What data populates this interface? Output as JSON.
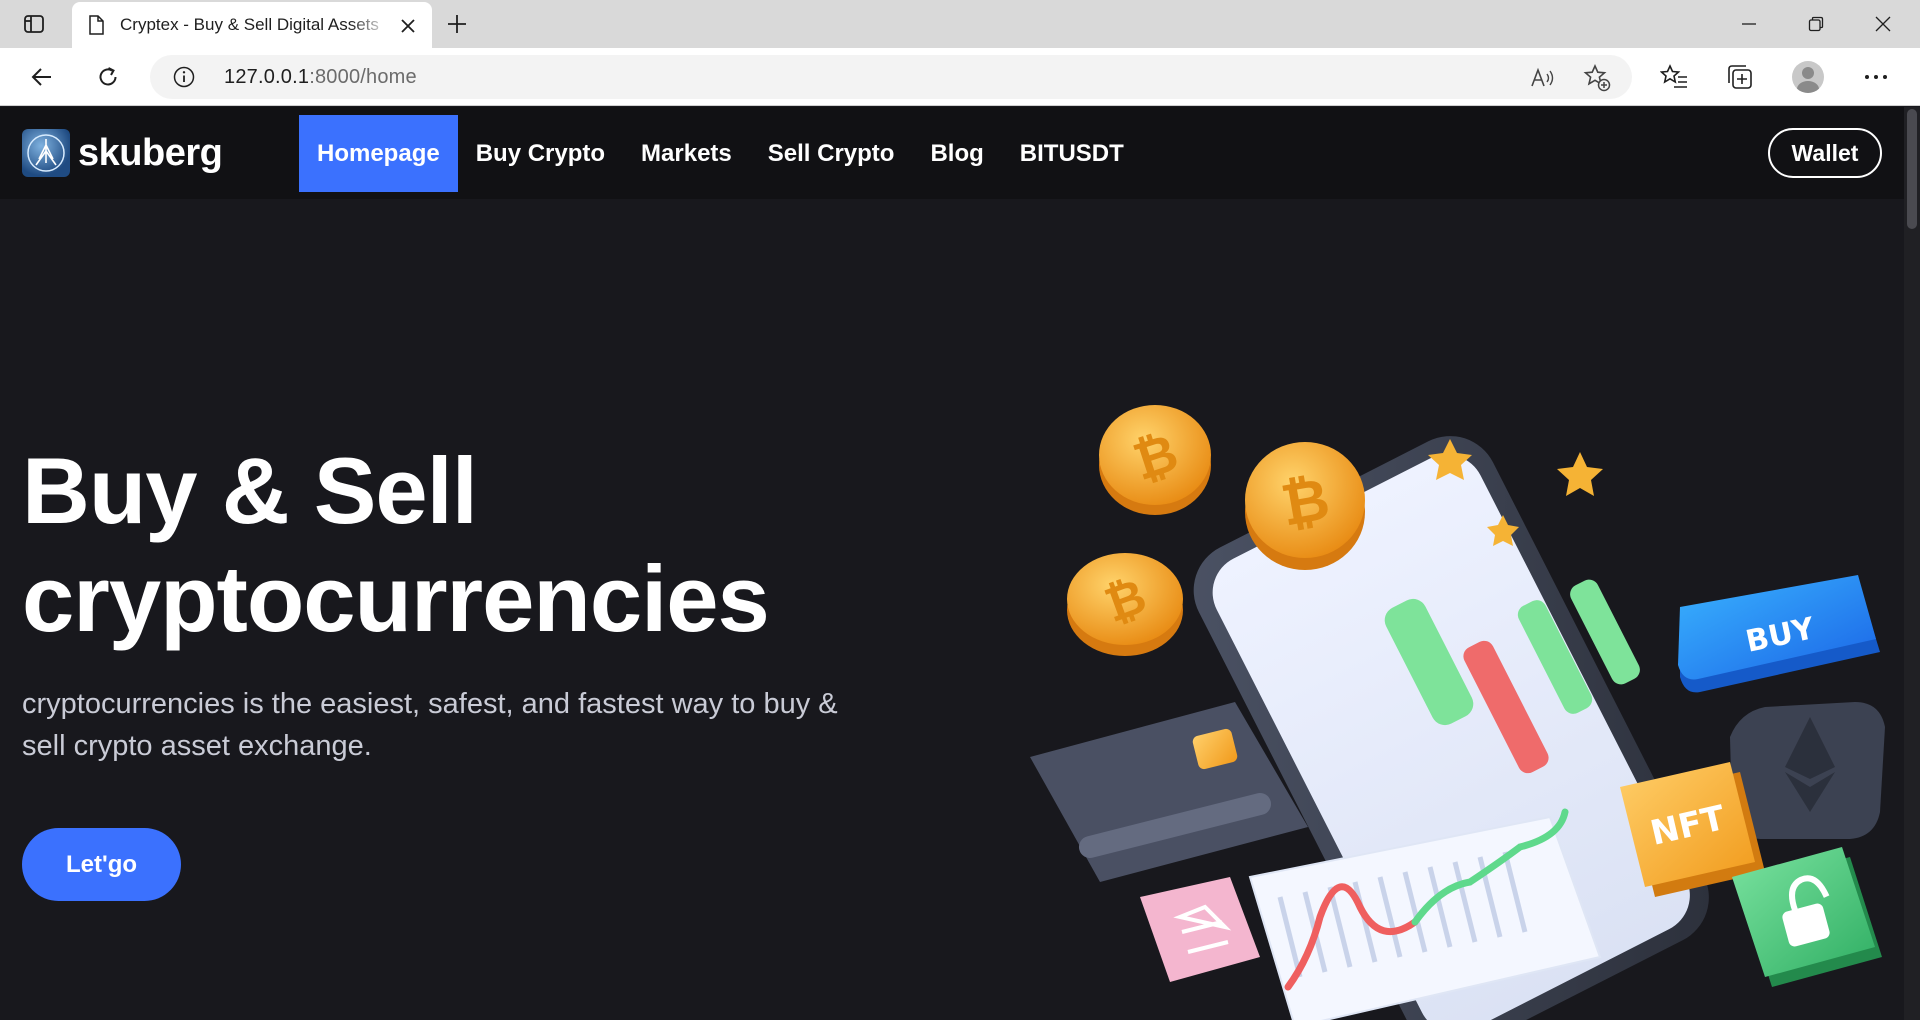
{
  "browser": {
    "tab_title": "Cryptex - Buy & Sell Digital Assets",
    "url_host": "127.0.0.1",
    "url_path": ":8000/home"
  },
  "site": {
    "brand": "skuberg",
    "nav": [
      "Homepage",
      "Buy Crypto",
      "Markets",
      "Sell Crypto",
      "Blog",
      "BITUSDT"
    ],
    "wallet_label": "Wallet",
    "hero": {
      "title_line1": "Buy & Sell",
      "title_line2": "cryptocurrencies",
      "description": "cryptocurrencies is the easiest, safest, and fastest way to buy & sell crypto asset exchange.",
      "cta_label": "Let'go"
    },
    "illustration": {
      "buy_label": "BUY",
      "nft_label": "NFT"
    }
  },
  "colors": {
    "accent": "#3b71fe",
    "background": "#18181d",
    "nav_background": "#111114"
  }
}
